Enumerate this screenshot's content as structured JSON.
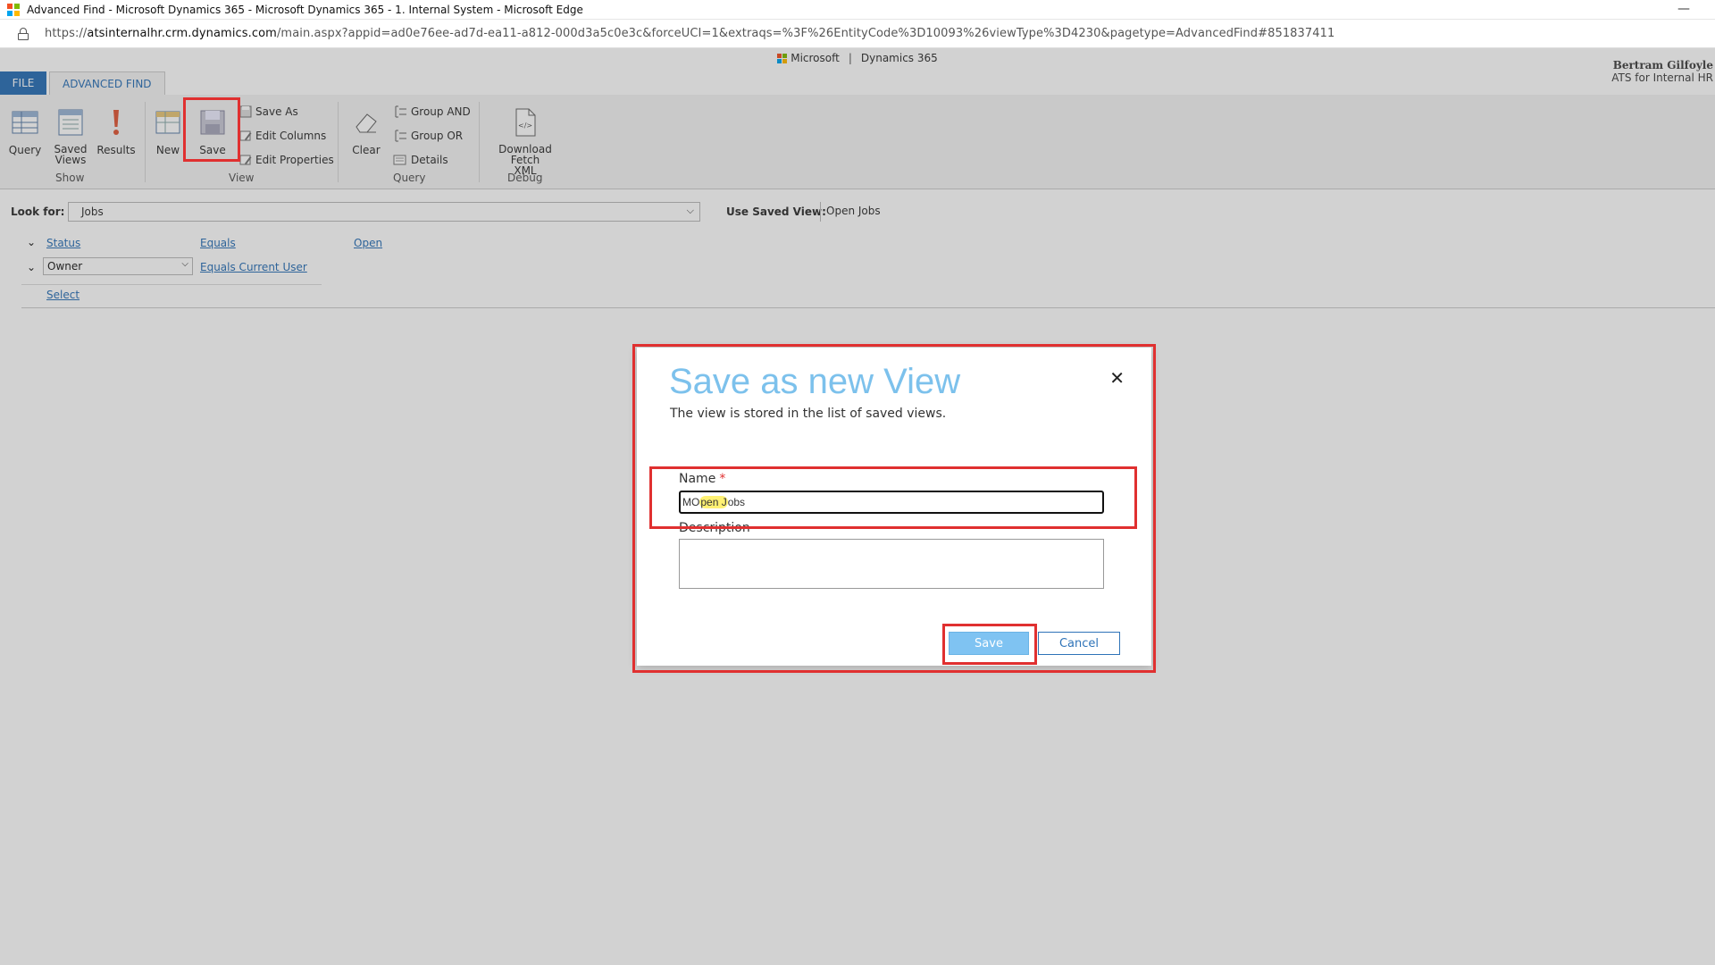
{
  "browser": {
    "window_title": "Advanced Find - Microsoft Dynamics 365 - Microsoft Dynamics 365 - 1. Internal System - Microsoft Edge",
    "minimize_glyph": "—",
    "url_prefix": "https://",
    "url_host": "atsinternalhr.crm.dynamics.com",
    "url_rest": "/main.aspx?appid=ad0e76ee-ad7d-ea11-a812-000d3a5c0e3c&forceUCI=1&extraqs=%3F%26EntityCode%3D10093%26viewType%3D4230&pagetype=AdvancedFind#851837411"
  },
  "brand": {
    "microsoft": "Microsoft",
    "separator": "|",
    "product": "Dynamics 365"
  },
  "user": {
    "name": "Bertram Gilfoyle",
    "org": "ATS for Internal HR"
  },
  "tabs": {
    "file": "FILE",
    "advanced_find": "ADVANCED FIND"
  },
  "ribbon": {
    "query": "Query",
    "saved_views_1": "Saved",
    "saved_views_2": "Views",
    "results": "Results",
    "new": "New",
    "save": "Save",
    "save_as": "Save As",
    "edit_columns": "Edit Columns",
    "edit_properties": "Edit Properties",
    "clear": "Clear",
    "group_and": "Group AND",
    "group_or": "Group OR",
    "details": "Details",
    "download_fetch_1": "Download Fetch",
    "download_fetch_2": "XML",
    "groups": {
      "show": "Show",
      "view": "View",
      "query": "Query",
      "debug": "Debug"
    }
  },
  "lookfor": {
    "label": "Look for:",
    "value": "Jobs",
    "saved_view_label": "Use Saved View:",
    "saved_view_value": "Open Jobs"
  },
  "criteria": {
    "row1_field": "Status",
    "row1_op": "Equals",
    "row1_value": "Open",
    "row2_field": "Owner",
    "row2_op": "Equals Current User",
    "select": "Select"
  },
  "dialog": {
    "title": "Save as new View",
    "subtitle": "The view is stored in the list of saved views.",
    "close_glyph": "✕",
    "name_label": "Name",
    "required_mark": "*",
    "name_value_prefix": "MO",
    "name_value_highlight": "pen J",
    "name_value_suffix": "obs",
    "description_label": "Description",
    "save_button": "Save",
    "cancel_button": "Cancel"
  },
  "colors": {
    "accent": "#2e73b8",
    "dialog_title": "#7cc1ec",
    "annotation_red": "#e03030",
    "save_button_bg": "#7fc3f2"
  }
}
